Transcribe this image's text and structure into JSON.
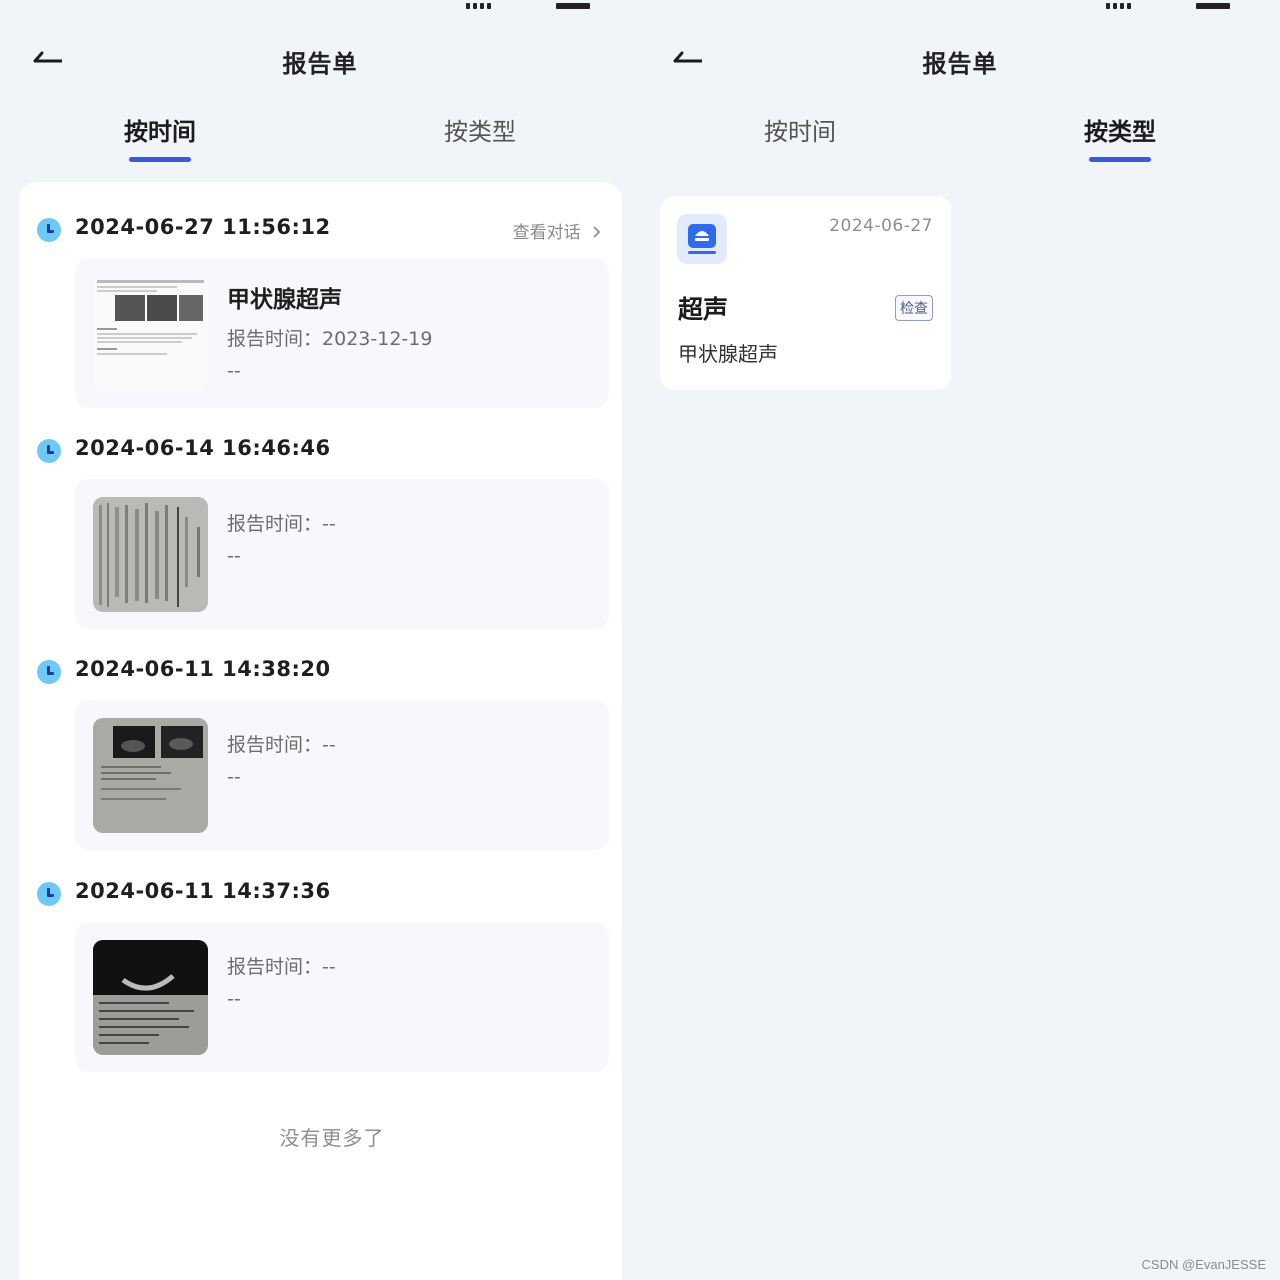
{
  "left": {
    "header": {
      "title": "报告单"
    },
    "tabs": [
      {
        "label": "按时间",
        "active": true
      },
      {
        "label": "按类型",
        "active": false
      }
    ],
    "groups": [
      {
        "time": "2024-06-27 11:56:12",
        "action": "查看对话",
        "report": {
          "title": "甲状腺超声",
          "label": "报告时间：",
          "date": "2023-12-19",
          "extra": "--"
        }
      },
      {
        "time": "2024-06-14 16:46:46",
        "action": "",
        "report": {
          "title": "",
          "label": "报告时间：",
          "date": "--",
          "extra": "--"
        }
      },
      {
        "time": "2024-06-11 14:38:20",
        "action": "",
        "report": {
          "title": "",
          "label": "报告时间：",
          "date": "--",
          "extra": "--"
        }
      },
      {
        "time": "2024-06-11 14:37:36",
        "action": "",
        "report": {
          "title": "",
          "label": "报告时间：",
          "date": "--",
          "extra": "--"
        }
      }
    ],
    "footer": "没有更多了"
  },
  "right": {
    "header": {
      "title": "报告单"
    },
    "tabs": [
      {
        "label": "按时间",
        "active": false
      },
      {
        "label": "按类型",
        "active": true
      }
    ],
    "card": {
      "icon": "ultrasound-icon",
      "date": "2024-06-27",
      "type": "超声",
      "badge": "检查",
      "subtitle": "甲状腺超声"
    }
  },
  "watermark": "CSDN @EvanJESSE",
  "colors": {
    "accent": "#3a5bd9",
    "background": "#f1f4f8",
    "clock": "#6fc8f5"
  }
}
